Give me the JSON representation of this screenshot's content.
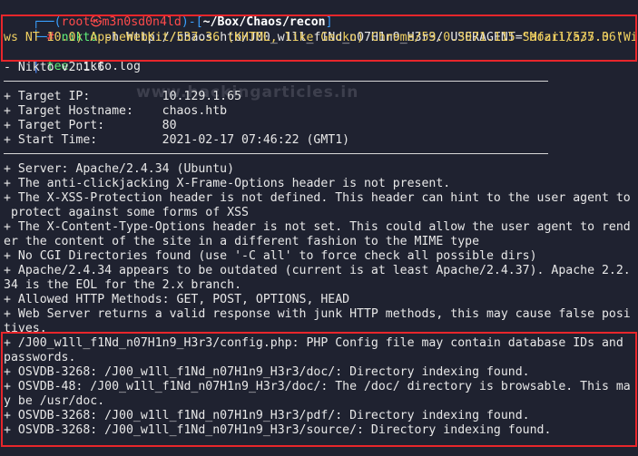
{
  "prompt": {
    "corner_top": "┌──(",
    "user_host": "root㉿m3n0sd0n4ld",
    "sep": ")-[",
    "path": "~/Box/Chaos/recon",
    "close": "]",
    "corner_bottom": "└─",
    "hash": "#"
  },
  "command": {
    "line1_cmd": "nikto",
    "line1_flag": " -h",
    "line1_url": " http://chaos.htb/J00_w1ll_f1Nd_n07H1n9_H3r3/",
    "line1_ua_key": " USERAGENT=",
    "line1_ua_val": "\"Mozilla/5.0 (Windo",
    "line2": "ws NT 10.0) AppleWebKit/537.36 (KHTML, like Gecko) Chrome/59.0.3071.115 Safari/537.36\"",
    "pipe": "|",
    "tee": " tee",
    "tee_file": " nikto.log"
  },
  "watermark": "www.hackingarticles.in",
  "output": {
    "version": "- Nikto v2.1.6",
    "target_ip": "+ Target IP:          10.129.1.65",
    "target_host": "+ Target Hostname:    chaos.htb",
    "target_port": "+ Target Port:        80",
    "start_time": "+ Start Time:         2021-02-17 07:46:22 (GMT1)",
    "findings": [
      "+ Server: Apache/2.4.34 (Ubuntu)",
      "+ The anti-clickjacking X-Frame-Options header is not present.",
      "+ The X-XSS-Protection header is not defined. This header can hint to the user agent to",
      " protect against some forms of XSS",
      "+ The X-Content-Type-Options header is not set. This could allow the user agent to rend",
      "er the content of the site in a different fashion to the MIME type",
      "+ No CGI Directories found (use '-C all' to force check all possible dirs)",
      "+ Apache/2.4.34 appears to be outdated (current is at least Apache/2.4.37). Apache 2.2.",
      "34 is the EOL for the 2.x branch.",
      "+ Allowed HTTP Methods: GET, POST, OPTIONS, HEAD",
      "+ Web Server returns a valid response with junk HTTP methods, this may cause false posi",
      "tives."
    ],
    "highlighted": [
      "+ /J00_w1ll_f1Nd_n07H1n9_H3r3/config.php: PHP Config file may contain database IDs and",
      "passwords.",
      "+ OSVDB-3268: /J00_w1ll_f1Nd_n07H1n9_H3r3/doc/: Directory indexing found.",
      "+ OSVDB-48: /J00_w1ll_f1Nd_n07H1n9_H3r3/doc/: The /doc/ directory is browsable. This ma",
      "y be /usr/doc.",
      "+ OSVDB-3268: /J00_w1ll_f1Nd_n07H1n9_H3r3/pdf/: Directory indexing found.",
      "+ OSVDB-3268: /J00_w1ll_f1Nd_n07H1n9_H3r3/source/: Directory indexing found."
    ]
  }
}
